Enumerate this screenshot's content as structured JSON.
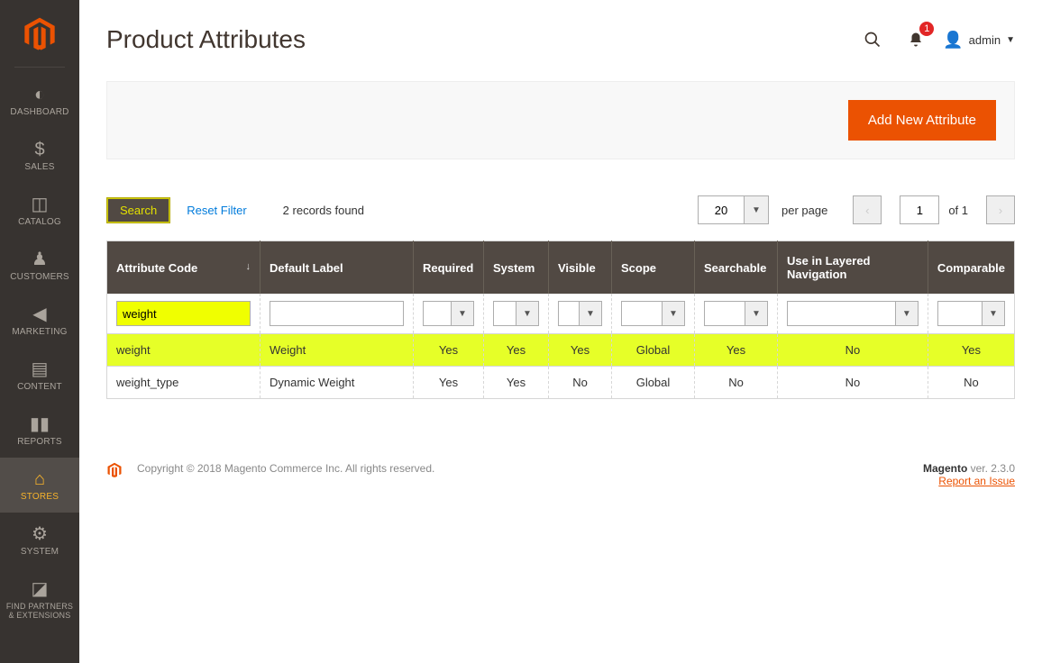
{
  "page_title": "Product Attributes",
  "admin_user": "admin",
  "notifications_count": "1",
  "sidebar": {
    "items": [
      {
        "label": "DASHBOARD",
        "icon": "◷"
      },
      {
        "label": "SALES",
        "icon": "$"
      },
      {
        "label": "CATALOG",
        "icon": "◧"
      },
      {
        "label": "CUSTOMERS",
        "icon": "👤"
      },
      {
        "label": "MARKETING",
        "icon": "📣"
      },
      {
        "label": "CONTENT",
        "icon": "▤"
      },
      {
        "label": "REPORTS",
        "icon": "📊"
      },
      {
        "label": "STORES",
        "icon": "🏬",
        "active": true
      },
      {
        "label": "SYSTEM",
        "icon": "⚙"
      },
      {
        "label": "FIND PARTNERS & EXTENSIONS",
        "icon": "◪"
      }
    ]
  },
  "action_bar": {
    "add_btn": "Add New Attribute"
  },
  "controls": {
    "search_btn": "Search",
    "reset_filter": "Reset Filter",
    "records_found": "2 records found",
    "per_page_value": "20",
    "per_page_label": "per page",
    "page_current": "1",
    "page_of": "of 1"
  },
  "table": {
    "headers": {
      "code": "Attribute Code",
      "label": "Default Label",
      "required": "Required",
      "system": "System",
      "visible": "Visible",
      "scope": "Scope",
      "searchable": "Searchable",
      "layered": "Use in Layered Navigation",
      "comparable": "Comparable"
    },
    "filter": {
      "code": "weight"
    },
    "rows": [
      {
        "code": "weight",
        "label": "Weight",
        "required": "Yes",
        "system": "Yes",
        "visible": "Yes",
        "scope": "Global",
        "searchable": "Yes",
        "layered": "No",
        "comparable": "Yes",
        "hl": true
      },
      {
        "code": "weight_type",
        "label": "Dynamic Weight",
        "required": "Yes",
        "system": "Yes",
        "visible": "No",
        "scope": "Global",
        "searchable": "No",
        "layered": "No",
        "comparable": "No",
        "hl": false
      }
    ]
  },
  "footer": {
    "copyright": "Copyright © 2018 Magento Commerce Inc. All rights reserved.",
    "magento": "Magento",
    "version": " ver. 2.3.0",
    "report": "Report an Issue"
  }
}
